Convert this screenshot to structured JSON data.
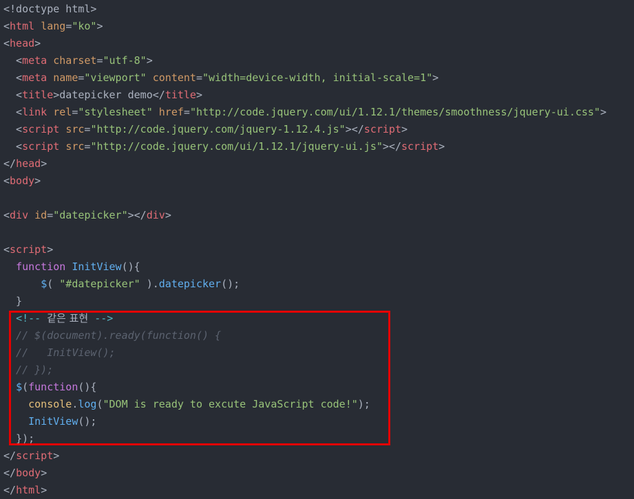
{
  "lines": [
    [
      {
        "t": "<!doctype html>",
        "c": "punct"
      }
    ],
    [
      {
        "t": "<",
        "c": "punct"
      },
      {
        "t": "html",
        "c": "tag"
      },
      {
        "t": " ",
        "c": "plain"
      },
      {
        "t": "lang",
        "c": "attr"
      },
      {
        "t": "=",
        "c": "punct"
      },
      {
        "t": "\"ko\"",
        "c": "str"
      },
      {
        "t": ">",
        "c": "punct"
      }
    ],
    [
      {
        "t": "<",
        "c": "punct"
      },
      {
        "t": "head",
        "c": "tag"
      },
      {
        "t": ">",
        "c": "punct"
      }
    ],
    [
      {
        "t": "  <",
        "c": "punct"
      },
      {
        "t": "meta",
        "c": "tag"
      },
      {
        "t": " ",
        "c": "plain"
      },
      {
        "t": "charset",
        "c": "attr"
      },
      {
        "t": "=",
        "c": "punct"
      },
      {
        "t": "\"utf-8\"",
        "c": "str"
      },
      {
        "t": ">",
        "c": "punct"
      }
    ],
    [
      {
        "t": "  <",
        "c": "punct"
      },
      {
        "t": "meta",
        "c": "tag"
      },
      {
        "t": " ",
        "c": "plain"
      },
      {
        "t": "name",
        "c": "attr"
      },
      {
        "t": "=",
        "c": "punct"
      },
      {
        "t": "\"viewport\"",
        "c": "str"
      },
      {
        "t": " ",
        "c": "plain"
      },
      {
        "t": "content",
        "c": "attr"
      },
      {
        "t": "=",
        "c": "punct"
      },
      {
        "t": "\"width=device-width, initial-scale=1\"",
        "c": "str"
      },
      {
        "t": ">",
        "c": "punct"
      }
    ],
    [
      {
        "t": "  <",
        "c": "punct"
      },
      {
        "t": "title",
        "c": "tag"
      },
      {
        "t": ">",
        "c": "punct"
      },
      {
        "t": "datepicker demo",
        "c": "plain"
      },
      {
        "t": "</",
        "c": "punct"
      },
      {
        "t": "title",
        "c": "tag"
      },
      {
        "t": ">",
        "c": "punct"
      }
    ],
    [
      {
        "t": "  <",
        "c": "punct"
      },
      {
        "t": "link",
        "c": "tag"
      },
      {
        "t": " ",
        "c": "plain"
      },
      {
        "t": "rel",
        "c": "attr"
      },
      {
        "t": "=",
        "c": "punct"
      },
      {
        "t": "\"stylesheet\"",
        "c": "str"
      },
      {
        "t": " ",
        "c": "plain"
      },
      {
        "t": "href",
        "c": "attr"
      },
      {
        "t": "=",
        "c": "punct"
      },
      {
        "t": "\"http://code.jquery.com/ui/1.12.1/themes/smoothness/jquery-ui.css\"",
        "c": "str"
      },
      {
        "t": ">",
        "c": "punct"
      }
    ],
    [
      {
        "t": "  <",
        "c": "punct"
      },
      {
        "t": "script",
        "c": "tag"
      },
      {
        "t": " ",
        "c": "plain"
      },
      {
        "t": "src",
        "c": "attr"
      },
      {
        "t": "=",
        "c": "punct"
      },
      {
        "t": "\"http://code.jquery.com/jquery-1.12.4.js\"",
        "c": "str"
      },
      {
        "t": "></",
        "c": "punct"
      },
      {
        "t": "script",
        "c": "tag"
      },
      {
        "t": ">",
        "c": "punct"
      }
    ],
    [
      {
        "t": "  <",
        "c": "punct"
      },
      {
        "t": "script",
        "c": "tag"
      },
      {
        "t": " ",
        "c": "plain"
      },
      {
        "t": "src",
        "c": "attr"
      },
      {
        "t": "=",
        "c": "punct"
      },
      {
        "t": "\"http://code.jquery.com/ui/1.12.1/jquery-ui.js\"",
        "c": "str"
      },
      {
        "t": "></",
        "c": "punct"
      },
      {
        "t": "script",
        "c": "tag"
      },
      {
        "t": ">",
        "c": "punct"
      }
    ],
    [
      {
        "t": "</",
        "c": "punct"
      },
      {
        "t": "head",
        "c": "tag"
      },
      {
        "t": ">",
        "c": "punct"
      }
    ],
    [
      {
        "t": "<",
        "c": "punct"
      },
      {
        "t": "body",
        "c": "tag"
      },
      {
        "t": ">",
        "c": "punct"
      }
    ],
    [],
    [
      {
        "t": "<",
        "c": "punct"
      },
      {
        "t": "div",
        "c": "tag"
      },
      {
        "t": " ",
        "c": "plain"
      },
      {
        "t": "id",
        "c": "attr"
      },
      {
        "t": "=",
        "c": "punct"
      },
      {
        "t": "\"datepicker\"",
        "c": "str"
      },
      {
        "t": "></",
        "c": "punct"
      },
      {
        "t": "div",
        "c": "tag"
      },
      {
        "t": ">",
        "c": "punct"
      }
    ],
    [],
    [
      {
        "t": "<",
        "c": "punct"
      },
      {
        "t": "script",
        "c": "tag"
      },
      {
        "t": ">",
        "c": "punct"
      }
    ],
    [
      {
        "t": "  ",
        "c": "plain"
      },
      {
        "t": "function",
        "c": "kw"
      },
      {
        "t": " ",
        "c": "plain"
      },
      {
        "t": "InitView",
        "c": "fn"
      },
      {
        "t": "(){",
        "c": "punct"
      }
    ],
    [
      {
        "t": "      ",
        "c": "plain"
      },
      {
        "t": "$",
        "c": "fn"
      },
      {
        "t": "( ",
        "c": "punct"
      },
      {
        "t": "\"#datepicker\"",
        "c": "str"
      },
      {
        "t": " ).",
        "c": "punct"
      },
      {
        "t": "datepicker",
        "c": "fn"
      },
      {
        "t": "();",
        "c": "punct"
      }
    ],
    [
      {
        "t": "  }",
        "c": "punct"
      }
    ],
    [
      {
        "t": "  ",
        "c": "plain"
      },
      {
        "t": "<!-- ",
        "c": "cyan"
      },
      {
        "t": "같은 표현",
        "c": "korean"
      },
      {
        "t": " -->",
        "c": "cyan"
      }
    ],
    [
      {
        "t": "  // $(document).ready(function() {",
        "c": "comment"
      }
    ],
    [
      {
        "t": "  //   InitView();",
        "c": "comment"
      }
    ],
    [
      {
        "t": "  // });",
        "c": "comment"
      }
    ],
    [
      {
        "t": "  ",
        "c": "plain"
      },
      {
        "t": "$",
        "c": "fn"
      },
      {
        "t": "(",
        "c": "punct"
      },
      {
        "t": "function",
        "c": "kw"
      },
      {
        "t": "(){",
        "c": "punct"
      }
    ],
    [
      {
        "t": "    ",
        "c": "plain"
      },
      {
        "t": "console",
        "c": "var"
      },
      {
        "t": ".",
        "c": "punct"
      },
      {
        "t": "log",
        "c": "fn"
      },
      {
        "t": "(",
        "c": "punct"
      },
      {
        "t": "\"DOM is ready to excute JavaScript code!\"",
        "c": "str"
      },
      {
        "t": ");",
        "c": "punct"
      }
    ],
    [
      {
        "t": "    ",
        "c": "plain"
      },
      {
        "t": "InitView",
        "c": "fn"
      },
      {
        "t": "();",
        "c": "punct"
      }
    ],
    [
      {
        "t": "  });",
        "c": "punct"
      }
    ],
    [
      {
        "t": "</",
        "c": "punct"
      },
      {
        "t": "script",
        "c": "tag"
      },
      {
        "t": ">",
        "c": "punct"
      }
    ],
    [
      {
        "t": "</",
        "c": "punct"
      },
      {
        "t": "body",
        "c": "tag"
      },
      {
        "t": ">",
        "c": "punct"
      }
    ],
    [
      {
        "t": "</",
        "c": "punct"
      },
      {
        "t": "html",
        "c": "tag"
      },
      {
        "t": ">",
        "c": "punct"
      }
    ]
  ],
  "colors": {
    "background": "#282c34",
    "punct": "#abb2bf",
    "tag": "#e06c75",
    "attr": "#d19a66",
    "str": "#98c379",
    "kw": "#c678dd",
    "fn": "#61afef",
    "var": "#e5c07b",
    "cyan": "#56b6c2",
    "comment": "#5c6370",
    "highlight_box": "#e60000"
  }
}
